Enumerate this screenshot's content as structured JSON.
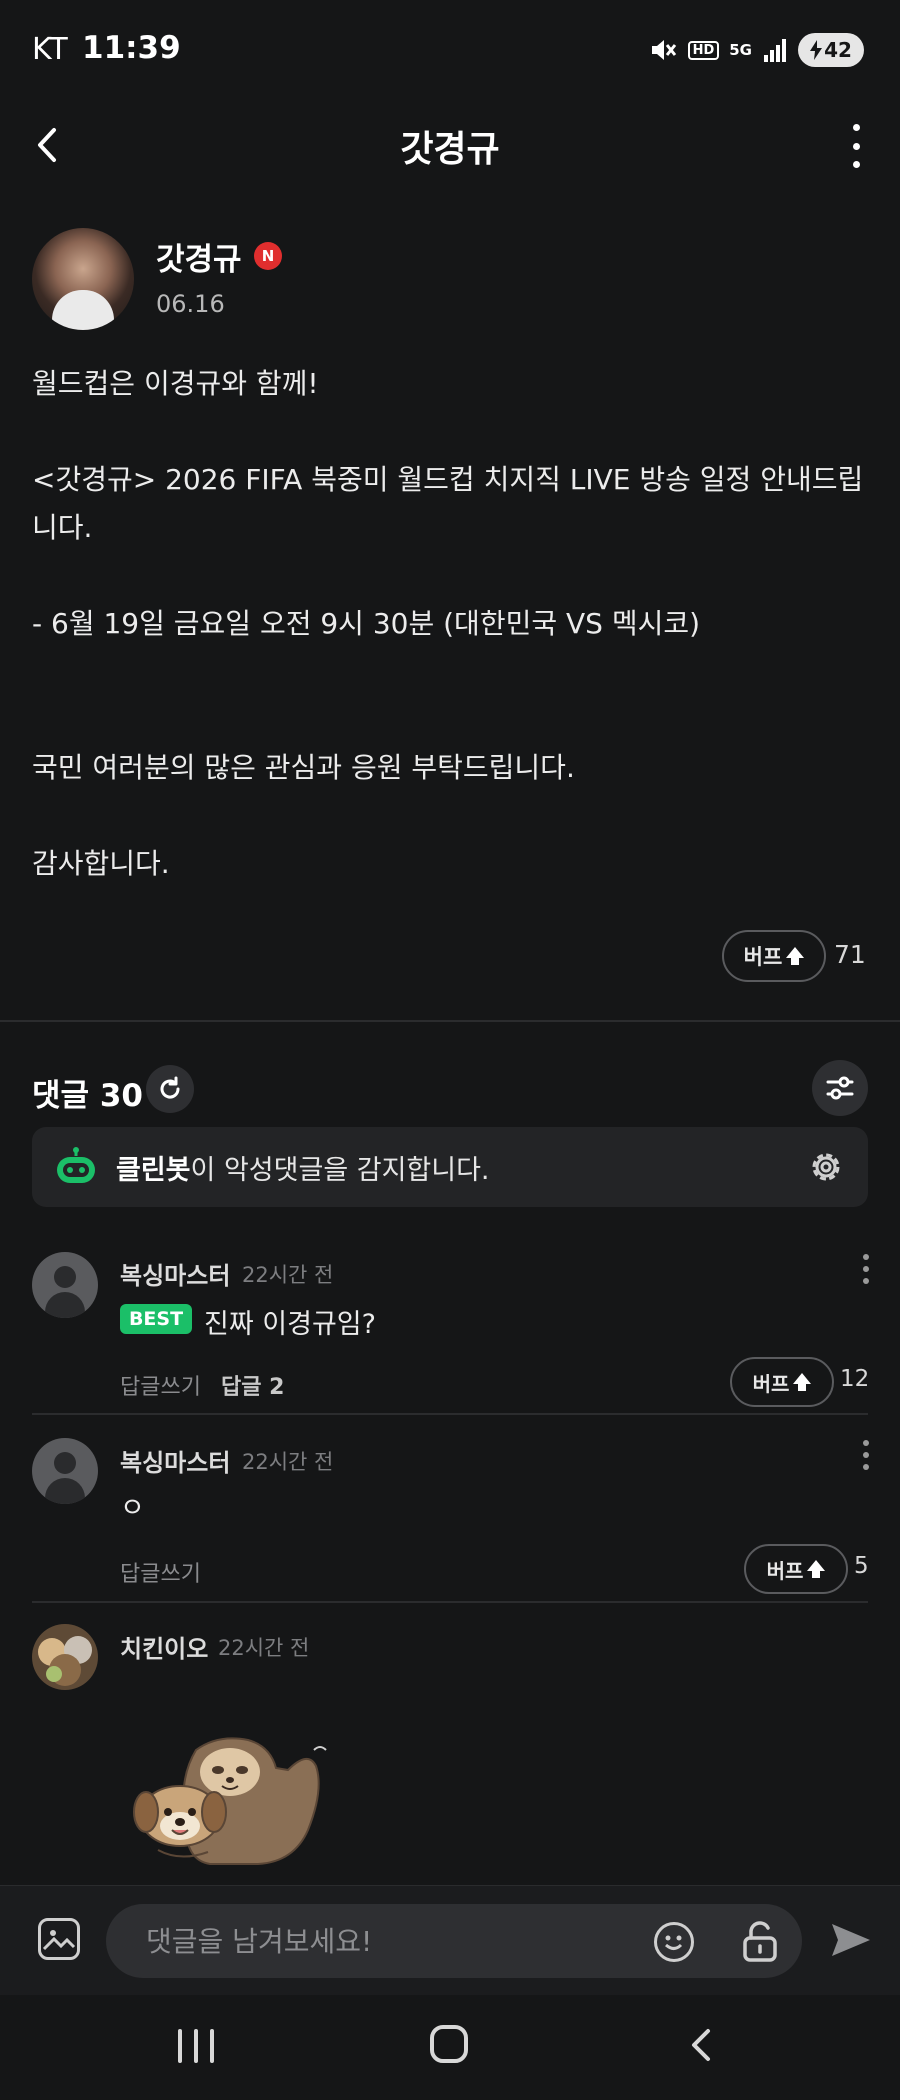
{
  "status": {
    "carrier": "KT",
    "time": "11:39",
    "hd": "HD",
    "network": "5G",
    "battery": "42"
  },
  "header": {
    "title": "갓경규",
    "back_icon": "chevron-left-icon",
    "more_icon": "more-vertical-icon"
  },
  "post": {
    "author": "갓경규",
    "author_badge": "N",
    "date": "06.16",
    "body": [
      "월드컵은 이경규와 함께!",
      "",
      "<갓경규> 2026 FIFA 북중미 월드컵 치지직 LIVE 방송 일정 안내드립니다.",
      "",
      "- 6월 19일 금요일 오전 9시 30분 (대한민국 VS 멕시코)",
      "",
      "",
      "국민 여러분의 많은 관심과 응원 부탁드립니다.",
      "",
      "감사합니다."
    ],
    "bump_label": "버프",
    "bump_count": "71"
  },
  "comments_section": {
    "title": "댓글",
    "count": "30",
    "cleanbot_name": "클린봇",
    "cleanbot_text": "이 악성댓글을 감지합니다."
  },
  "comments": [
    {
      "author": "복싱마스터",
      "time": "22시간 전",
      "badge": "BEST",
      "text": "진짜 이경규임?",
      "reply_label": "답글쓰기",
      "replies_label": "답글 2",
      "bump_label": "버프",
      "bump_count": "12"
    },
    {
      "author": "복싱마스터",
      "time": "22시간 전",
      "text": "ㅇ",
      "reply_label": "답글쓰기",
      "bump_label": "버프",
      "bump_count": "5"
    },
    {
      "author": "치킨이오",
      "time": "22시간 전",
      "sticker": "sloth-and-dog-sticker"
    }
  ],
  "input_bar": {
    "placeholder": "댓글을 남겨보세요!"
  },
  "colors": {
    "background": "#151617",
    "best_badge": "#1bbf68",
    "new_badge": "#e02e2e",
    "cleanbot_icon": "#1bbf68"
  }
}
